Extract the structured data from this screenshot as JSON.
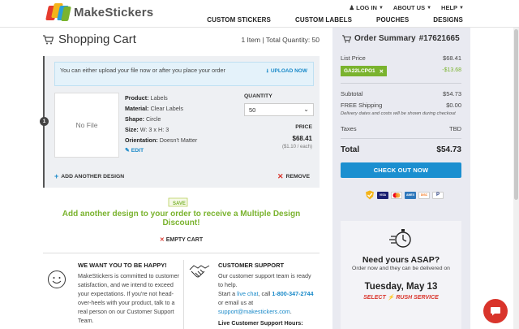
{
  "header": {
    "logo_text": "MakeStickers",
    "top_links": [
      "LOG IN",
      "ABOUT US",
      "HELP"
    ],
    "nav": [
      "CUSTOM STICKERS",
      "CUSTOM LABELS",
      "POUCHES",
      "DESIGNS"
    ]
  },
  "cart": {
    "title": "Shopping Cart",
    "meta": "1 Item  |  Total Quantity: 50",
    "notice": "You can either upload your file now or after you place your order",
    "upload_label": "UPLOAD NOW",
    "item": {
      "badge": "1",
      "preview": "No File",
      "details": [
        {
          "key": "Product:",
          "value": "Labels"
        },
        {
          "key": "Material:",
          "value": "Clear Labels"
        },
        {
          "key": "Shape:",
          "value": "Circle"
        },
        {
          "key": "Size:",
          "value": "W: 3 x H: 3"
        },
        {
          "key": "Orientation:",
          "value": "Doesn't Matter"
        }
      ],
      "edit_label": "EDIT",
      "quantity_label": "QUANTITY",
      "quantity_value": "50",
      "price_label": "PRICE",
      "price": "$68.41",
      "each": "($1.10 / each)",
      "add_label": "ADD ANOTHER DESIGN",
      "remove_label": "REMOVE"
    },
    "save_tag": "SAVE",
    "discount_text": "Add another design to your order to receive a Multiple Design Discount!",
    "empty_label": "EMPTY CART"
  },
  "happy": {
    "title": "WE WANT YOU TO BE HAPPY!",
    "text": "MakeStickers is committed to customer satisfaction, and we intend to exceed your expectations. If you're not head-over-heels with your product, talk to a real person on our Customer Support Team."
  },
  "support": {
    "title": "CUSTOMER SUPPORT",
    "line1": "Our customer support team is ready to help.",
    "start": "Start a ",
    "chat_link": "live chat",
    "call": ", call ",
    "phone": "1-800-347-2744",
    "email_pre": " or email us at ",
    "email": "support@makestickers.com",
    "end": ".",
    "hours": "Live Customer Support Hours:"
  },
  "summary": {
    "title": "Order Summary",
    "order_no": "#17621665",
    "list_price_label": "List Price",
    "list_price": "$68.41",
    "coupon": "GA22LCPO1",
    "coupon_discount": "-$13.68",
    "subtotal_label": "Subtotal",
    "subtotal": "$54.73",
    "shipping_label": "FREE Shipping",
    "shipping": "$0.00",
    "shipping_note": "Delivery dates and costs will be shown during checkout",
    "taxes_label": "Taxes",
    "taxes": "TBD",
    "total_label": "Total",
    "total": "$54.73",
    "checkout_label": "CHECK OUT NOW",
    "payment_icons": [
      "norton-icon",
      "visa-icon",
      "mastercard-icon",
      "amex-icon",
      "discover-icon",
      "paypal-icon"
    ]
  },
  "asap": {
    "title": "Need yours ASAP?",
    "sub": "Order now and they can be delivered on",
    "date": "Tuesday, May 13",
    "rush": "SELECT ⚡ RUSH SERVICE"
  },
  "colors": {
    "accent_blue": "#1b8fd0",
    "green": "#7ab32e",
    "red": "#d9342b",
    "sidebar_bg": "#e9eaf1"
  }
}
